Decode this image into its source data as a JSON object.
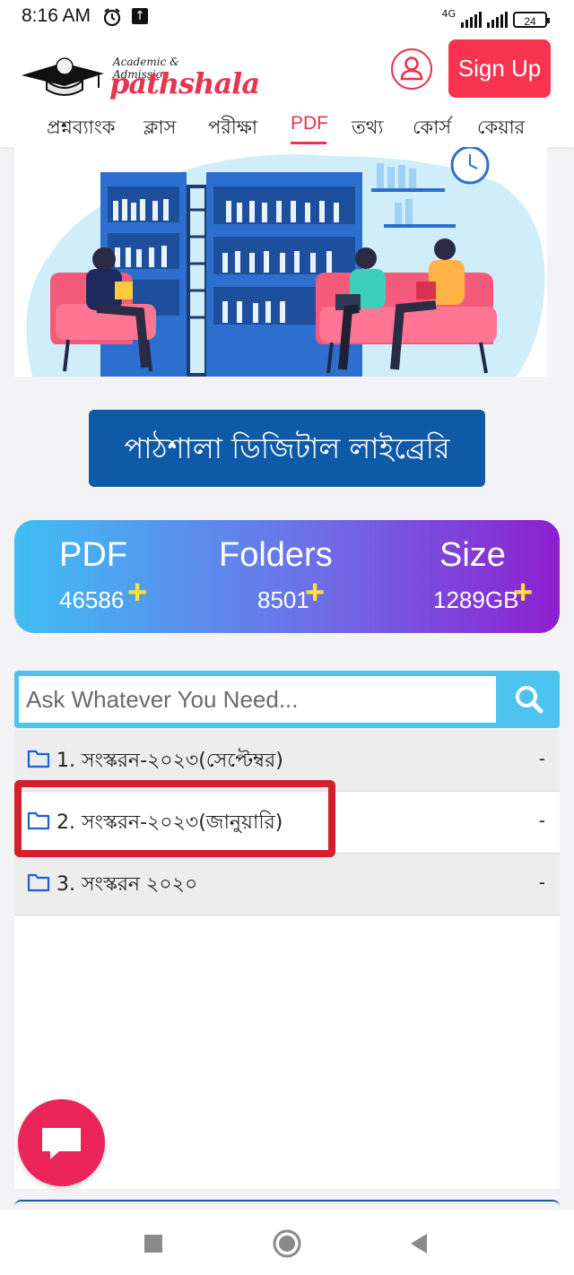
{
  "status_bar": {
    "time": "8:16 AM",
    "network": "4G",
    "battery": "24"
  },
  "header": {
    "logo_sub": "Academic & Admission",
    "logo_main": "pathshala",
    "signup_label": "Sign Up",
    "nav": [
      {
        "label": "প্রশ্নব্যাংক"
      },
      {
        "label": "ক্লাস"
      },
      {
        "label": "পরীক্ষা"
      },
      {
        "label": "PDF"
      },
      {
        "label": "তথ্য"
      },
      {
        "label": "কোর্স"
      },
      {
        "label": "কেয়ার"
      }
    ]
  },
  "library_button": "পাঠশালা ডিজিটাল লাইব্রেরি",
  "stats": [
    {
      "label": "PDF",
      "value": "46586",
      "suffix": "+"
    },
    {
      "label": "Folders",
      "value": "8501",
      "suffix": "+"
    },
    {
      "label": "Size",
      "value": "1289GB",
      "suffix": "+"
    }
  ],
  "search": {
    "placeholder": "Ask Whatever You Need..."
  },
  "folders": [
    {
      "name": "1. সংস্করন-২০২৩(সেপ্টেম্বর)",
      "meta": "-"
    },
    {
      "name": "2. সংস্করন-২০২৩(জানুয়ারি)",
      "meta": "-"
    },
    {
      "name": "3. সংস্করন ২০২০",
      "meta": "-"
    }
  ],
  "colors": {
    "accent": "#e8344f",
    "primary_blue": "#0e5aa7",
    "highlight_red": "#d61f2c"
  }
}
